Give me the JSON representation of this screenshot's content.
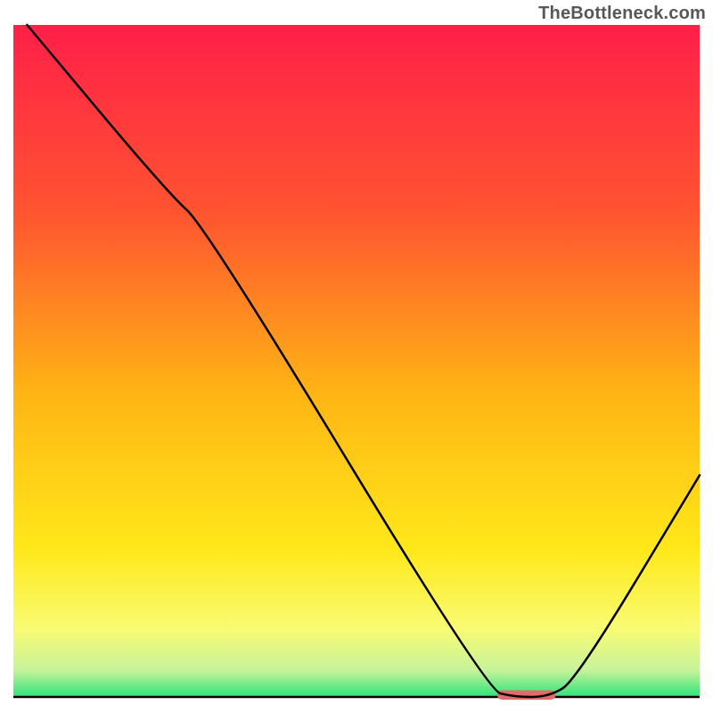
{
  "watermark": "TheBottleneck.com",
  "chart_data": {
    "type": "line",
    "title": "",
    "xlabel": "",
    "ylabel": "",
    "xlim": [
      0,
      100
    ],
    "ylim": [
      0,
      100
    ],
    "grid": false,
    "legend": null,
    "gradient_stops": [
      {
        "offset": 0.0,
        "color": "#ff1f49"
      },
      {
        "offset": 0.28,
        "color": "#ff5430"
      },
      {
        "offset": 0.55,
        "color": "#ffb514"
      },
      {
        "offset": 0.78,
        "color": "#ffe81a"
      },
      {
        "offset": 0.9,
        "color": "#f8fb74"
      },
      {
        "offset": 0.96,
        "color": "#c7f39b"
      },
      {
        "offset": 1.0,
        "color": "#2ee37a"
      }
    ],
    "series": [
      {
        "name": "bottleneck-curve",
        "color": "#000000",
        "points": [
          {
            "x": 2.0,
            "y": 100.0
          },
          {
            "x": 22.5,
            "y": 75.0
          },
          {
            "x": 28.0,
            "y": 70.0
          },
          {
            "x": 69.0,
            "y": 1.0
          },
          {
            "x": 73.0,
            "y": 0.0
          },
          {
            "x": 78.0,
            "y": 0.0
          },
          {
            "x": 82.0,
            "y": 2.5
          },
          {
            "x": 100.0,
            "y": 33.0
          }
        ]
      }
    ],
    "marker": {
      "name": "optimal-range",
      "x_start": 70.5,
      "x_end": 79.0,
      "y": 0.3,
      "thickness_pct": 1.4,
      "color": "#e26a6a"
    },
    "baseline": {
      "y": 0.0,
      "color": "#000000"
    }
  }
}
